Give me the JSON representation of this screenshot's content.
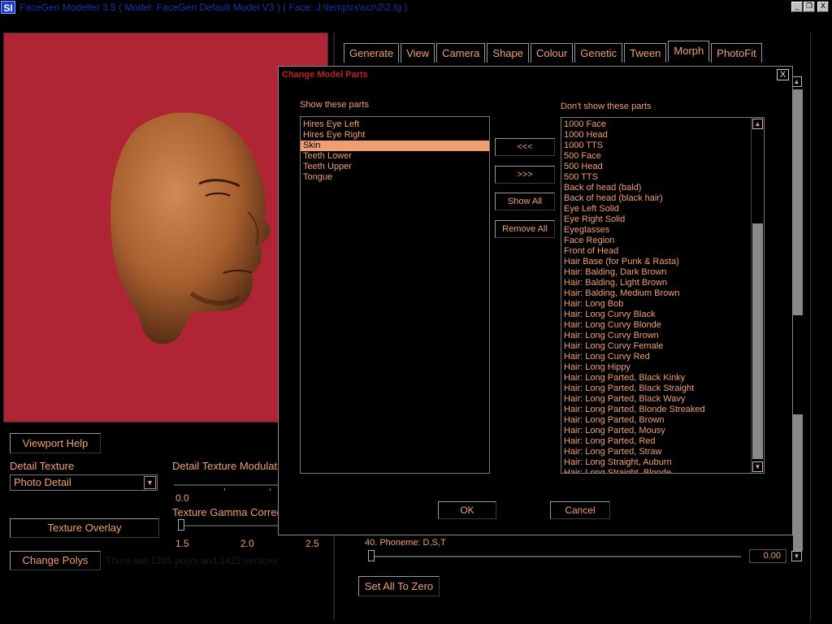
{
  "window": {
    "logo": "SI",
    "title": "FaceGen Modeller 3.5  ( Model: FaceGen Default Model V3 )  ( Face: J:\\temp\\rs\\scr\\2\\2.fg )",
    "minimize": "_",
    "restore": "❐",
    "close": "X"
  },
  "left": {
    "viewport_help": "Viewport Help",
    "detail_texture_label": "Detail Texture",
    "detail_texture_value": "Photo Detail",
    "detail_mod_label": "Detail Texture Modulat",
    "detail_mod_min": "0.0",
    "texture_overlay": "Texture Overlay",
    "gamma_label": "Texture Gamma Correc",
    "gamma_ticks": [
      "1.5",
      "2.0",
      "2.5"
    ],
    "change_polys": "Change Polys",
    "polys_text": "There are 1201 polys and 1421 vertices"
  },
  "tabs": [
    "Generate",
    "View",
    "Camera",
    "Shape",
    "Colour",
    "Genetic",
    "Tween",
    "Morph",
    "PhotoFit"
  ],
  "active_tab": "Morph",
  "morph": {
    "phoneme_label": "40.  Phoneme: D,S,T",
    "phoneme_value": "0.00",
    "set_all_zero": "Set All To Zero"
  },
  "dialog": {
    "title": "Change Model Parts",
    "close": "X",
    "show_label": "Show these parts",
    "hide_label": "Don't show these parts",
    "show_items": [
      "Hires Eye Left",
      "Hires Eye Right",
      "Skin",
      "Teeth Lower",
      "Teeth Upper",
      "Tongue"
    ],
    "selected_item": "Skin",
    "hide_items": [
      "1000 Face",
      "1000 Head",
      "1000 TTS",
      "500 Face",
      "500 Head",
      "500 TTS",
      "Back of head (bald)",
      "Back of head (black hair)",
      "Eye Left Solid",
      "Eye Right Solid",
      "Eyeglasses",
      "Face Region",
      "Front of Head",
      "Hair Base (for Punk & Rasta)",
      "Hair: Balding, Dark Brown",
      "Hair: Balding, Light Brown",
      "Hair: Balding, Medium Brown",
      "Hair: Long Bob",
      "Hair: Long Curvy Black",
      "Hair: Long Curvy Blonde",
      "Hair: Long Curvy Brown",
      "Hair: Long Curvy Female",
      "Hair: Long Curvy Red",
      "Hair: Long Hippy",
      "Hair: Long Parted, Black Kinky",
      "Hair: Long Parted, Black Straight",
      "Hair: Long Parted, Black Wavy",
      "Hair: Long Parted, Blonde Streaked",
      "Hair: Long Parted, Brown",
      "Hair: Long Parted, Mousy",
      "Hair: Long Parted, Red",
      "Hair: Long Parted, Straw",
      "Hair: Long Straight, Auburn",
      "Hair: Long Straight, Blonde"
    ],
    "btn_add": "<<<",
    "btn_remove": ">>>",
    "btn_show_all": "Show All",
    "btn_remove_all": "Remove All",
    "ok": "OK",
    "cancel": "Cancel"
  },
  "colors": {
    "accent_text": "#f0a070",
    "viewport_bg": "#b02535",
    "dialog_title": "#c02020",
    "title_text": "#1a2fb0"
  }
}
